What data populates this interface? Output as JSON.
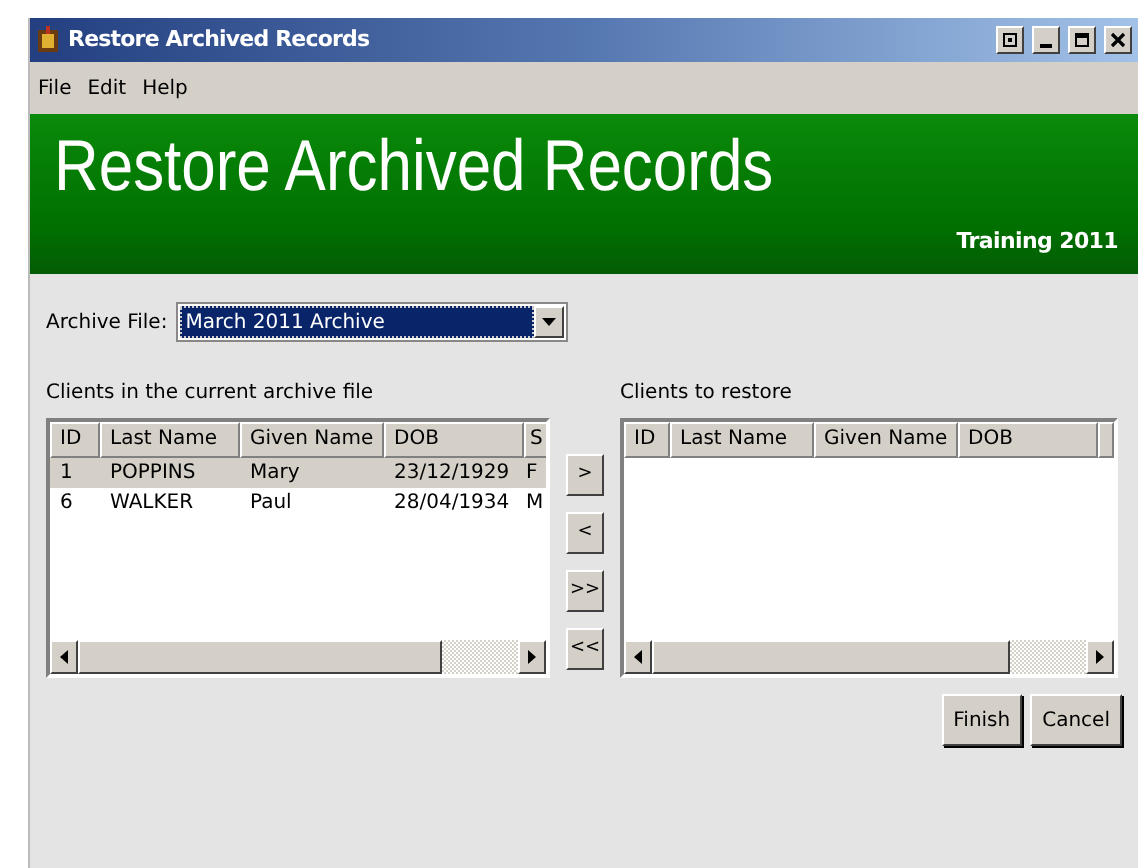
{
  "window": {
    "title": "Restore Archived Records"
  },
  "menu": [
    "File",
    "Edit",
    "Help"
  ],
  "banner": {
    "title": "Restore Archived Records",
    "subtitle": "Training 2011"
  },
  "archive_file": {
    "label": "Archive File:",
    "value": "March 2011 Archive"
  },
  "current_clients": {
    "label": "Clients in the current archive file",
    "columns": [
      "ID",
      "Last Name",
      "Given Name",
      "DOB",
      "S"
    ],
    "rows": [
      {
        "cells": [
          "1",
          "POPPINS",
          "Mary",
          "23/12/1929",
          "F"
        ],
        "selected": true
      },
      {
        "cells": [
          "6",
          "WALKER",
          "Paul",
          "28/04/1934",
          "M"
        ],
        "selected": false
      }
    ]
  },
  "move_buttons": [
    ">",
    "<",
    ">>",
    "<<"
  ],
  "restore_clients": {
    "label": "Clients to restore",
    "columns": [
      "ID",
      "Last Name",
      "Given Name",
      "DOB"
    ]
  },
  "buttons": [
    "Finish",
    "Cancel"
  ]
}
